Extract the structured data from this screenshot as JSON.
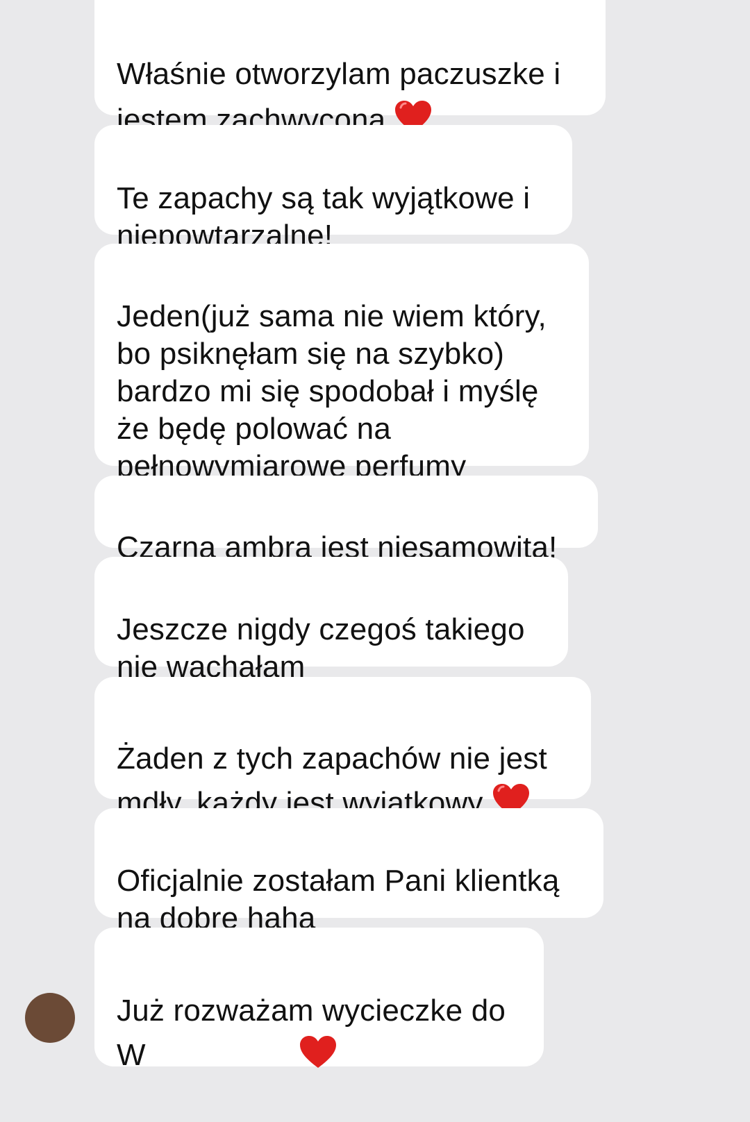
{
  "messages": [
    {
      "text": "Właśnie otworzylam paczuszke i\njestem zachwycona",
      "emoji": "red-heart"
    },
    {
      "text": "Te zapachy są tak wyjątkowe i\nniepowtarzalne!"
    },
    {
      "text": "Jeden(już sama nie wiem który,\nbo psiknęłam się na szybko)\nbardzo mi się spodobał i myślę\nże będę polować na\npełnowymiarowe perfumy"
    },
    {
      "text": "Czarna ambra jest niesamowita!"
    },
    {
      "text": "Jeszcze nigdy czegoś takiego\nnie wąchałam"
    },
    {
      "text": "Żaden z tych zapachów nie jest\nmdły, każdy jest wyjątkowy",
      "emoji": "red-heart"
    },
    {
      "text": "Oficjalnie zostałam Pani klientką\nna dobre haha"
    },
    {
      "text": "Już rozważam wycieczke do\nW",
      "emoji": "red-heart"
    }
  ],
  "colors": {
    "background": "#e9e9eb",
    "bubble": "#ffffff",
    "text": "#111111",
    "heart": "#e0201e"
  }
}
